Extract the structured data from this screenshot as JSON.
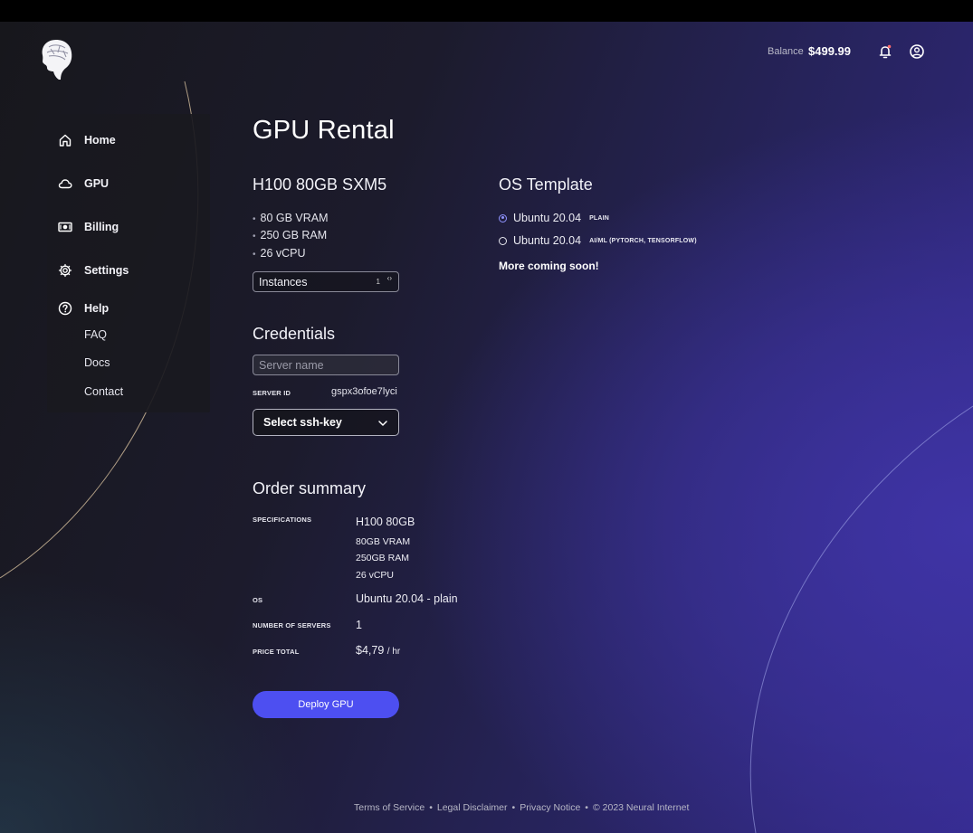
{
  "header": {
    "balance_label": "Balance",
    "balance_amount": "$499.99",
    "icons": [
      "brain-head-logo",
      "bell-icon",
      "user-icon"
    ]
  },
  "sidebar": {
    "items": [
      {
        "label": "Home",
        "icon": "home-icon"
      },
      {
        "label": "GPU",
        "icon": "cloud-icon"
      },
      {
        "label": "Billing",
        "icon": "money-icon"
      },
      {
        "label": "Settings",
        "icon": "gear-icon"
      },
      {
        "label": "Help",
        "icon": "help-icon"
      }
    ],
    "help_links": [
      "FAQ",
      "Docs",
      "Contact"
    ]
  },
  "main": {
    "title": "GPU Rental",
    "gpu": {
      "name": "H100 80GB SXM5",
      "specs": [
        "80 GB VRAM",
        "250 GB RAM",
        "26 vCPU"
      ],
      "instances_label": "Instances",
      "instances_value": "1"
    },
    "credentials": {
      "title": "Credentials",
      "server_name_placeholder": "Server name",
      "server_id_label": "SERVER ID",
      "server_id_value": "gspx3ofoe7lyci",
      "ssh_key_label": "Select ssh-key"
    },
    "order_summary": {
      "title": "Order summary",
      "specifications_label": "SPECIFICATIONS",
      "specifications_values": [
        "H100 80GB",
        "80GB VRAM",
        "250GB RAM",
        "26 vCPU"
      ],
      "os_label": "OS",
      "os_value": "Ubuntu 20.04 - plain",
      "servers_label": "NUMBER OF SERVERS",
      "servers_value": "1",
      "price_label": "PRICE TOTAL",
      "price_value": "$4,79",
      "price_unit": "/ hr"
    },
    "deploy_label": "Deploy GPU"
  },
  "os_template": {
    "title": "OS Template",
    "options": [
      {
        "name": "Ubuntu 20.04",
        "tag": "PLAIN",
        "selected": true
      },
      {
        "name": "Ubuntu 20.04",
        "tag": "AI/ML (PYTORCH, TENSORFLOW)",
        "selected": false
      }
    ],
    "coming_soon": "More coming soon!"
  },
  "footer": {
    "links": [
      "Terms of Service",
      "Legal Disclaimer",
      "Privacy Notice"
    ],
    "separator": "•",
    "copyright": "© 2023 Neural Internet"
  },
  "colors": {
    "accent": "#4d4ff1",
    "radio_selected": "#8f93ff"
  }
}
